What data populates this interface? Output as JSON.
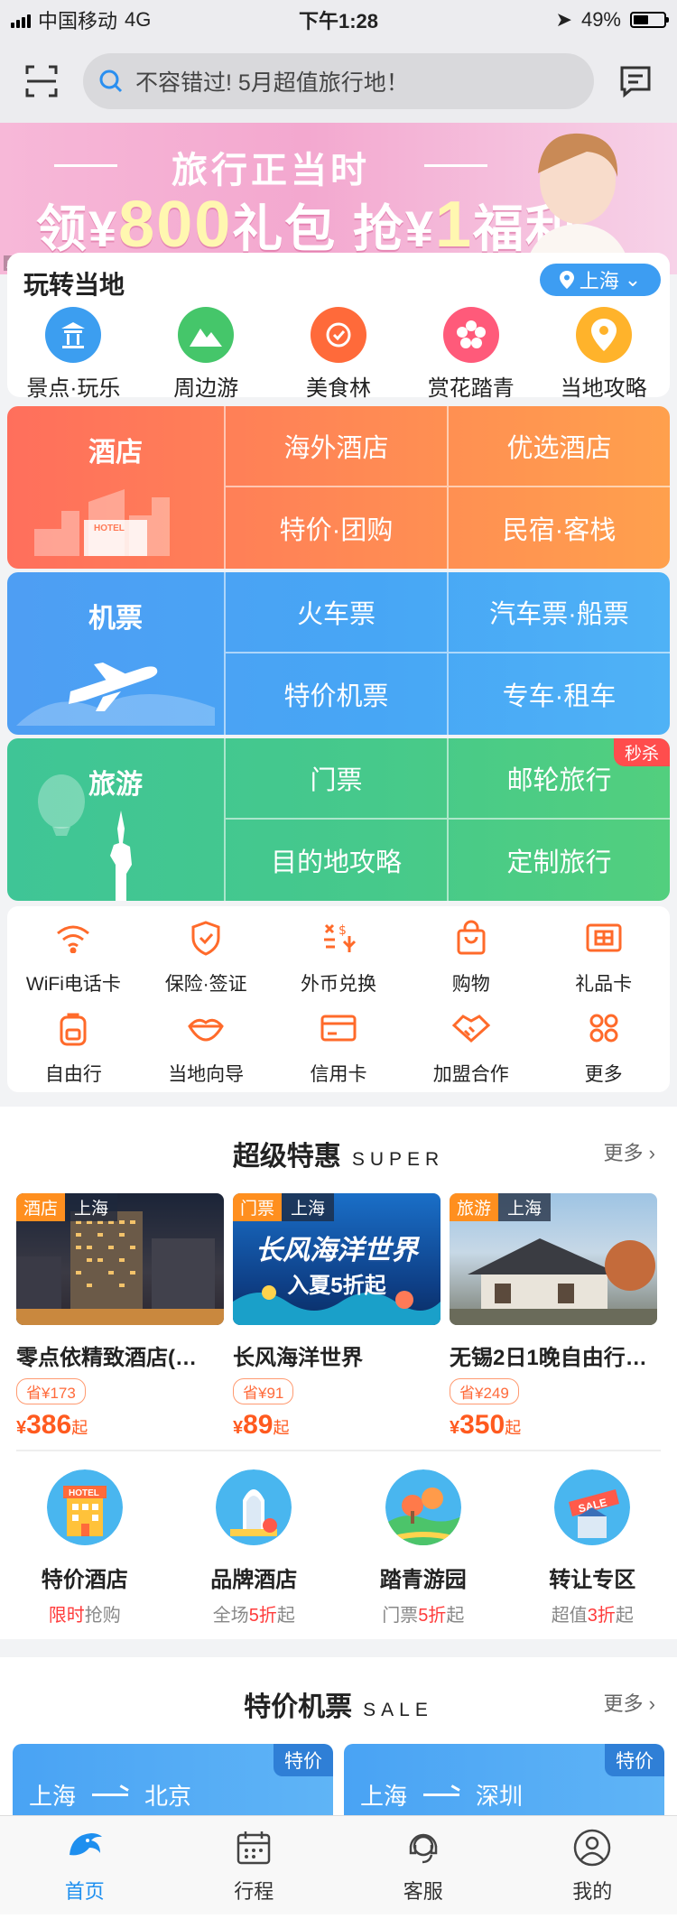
{
  "status_bar": {
    "carrier": "中国移动",
    "network": "4G",
    "time": "下午1:28",
    "battery": "49%",
    "battery_level": 0.49
  },
  "header": {
    "search_placeholder": "不容错过! 5月超值旅行地！"
  },
  "banner": {
    "line1": "旅行正当时",
    "line2_a": "领¥",
    "line2_num": "800",
    "line2_b": "礼包 抢¥",
    "line2_num2": "1",
    "line2_c": "福利",
    "ad_tag": "广告"
  },
  "local": {
    "title": "玩转当地",
    "city": "上海",
    "items": [
      {
        "label": "景点·玩乐",
        "icon": "attraction-icon",
        "color": "#3c9ef0"
      },
      {
        "label": "周边游",
        "icon": "mountain-icon",
        "color": "#45c66a"
      },
      {
        "label": "美食林",
        "icon": "food-icon",
        "color": "#ff6a3a"
      },
      {
        "label": "赏花踏青",
        "icon": "flower-icon",
        "color": "#ff5a7a"
      },
      {
        "label": "当地攻略",
        "icon": "guide-icon",
        "color": "#ffb32b"
      }
    ]
  },
  "grid": {
    "hotel": {
      "main": "酒店",
      "cells": [
        "海外酒店",
        "优选酒店",
        "特价·团购",
        "民宿·客栈"
      ]
    },
    "flight": {
      "main": "机票",
      "cells": [
        "火车票",
        "汽车票·船票",
        "特价机票",
        "专车·租车"
      ]
    },
    "tour": {
      "main": "旅游",
      "cells": [
        "门票",
        "邮轮旅行",
        "目的地攻略",
        "定制旅行"
      ],
      "badge": "秒杀"
    }
  },
  "services": [
    {
      "label": "WiFi电话卡",
      "icon": "wifi-icon"
    },
    {
      "label": "保险·签证",
      "icon": "shield-icon"
    },
    {
      "label": "外币兑换",
      "icon": "currency-exchange-icon"
    },
    {
      "label": "购物",
      "icon": "shopping-bag-icon"
    },
    {
      "label": "礼品卡",
      "icon": "gift-card-icon"
    },
    {
      "label": "自由行",
      "icon": "backpack-icon"
    },
    {
      "label": "当地向导",
      "icon": "guide-lips-icon"
    },
    {
      "label": "信用卡",
      "icon": "credit-card-icon"
    },
    {
      "label": "加盟合作",
      "icon": "handshake-icon"
    },
    {
      "label": "更多",
      "icon": "more-grid-icon"
    }
  ],
  "super": {
    "title": "超级特惠",
    "title_en": "SUPER",
    "more": "更多",
    "deals": [
      {
        "tag": "酒店",
        "city": "上海",
        "name": "零点依精致酒店(…",
        "save": "省¥173",
        "currency": "¥",
        "price": "386",
        "unit": "起"
      },
      {
        "tag": "门票",
        "city": "上海",
        "name": "长风海洋世界",
        "save": "省¥91",
        "currency": "¥",
        "price": "89",
        "unit": "起",
        "img_title": "长风海洋世界",
        "img_sub": "入夏5折起"
      },
      {
        "tag": "旅游",
        "city": "上海",
        "name": "无锡2日1晚自由行…",
        "save": "省¥249",
        "currency": "¥",
        "price": "350",
        "unit": "起"
      }
    ],
    "promos": [
      {
        "title": "特价酒店",
        "sub_a": "",
        "sub_hl": "限时",
        "sub_b": "抢购"
      },
      {
        "title": "品牌酒店",
        "sub_a": "全场",
        "sub_hl": "5折",
        "sub_b": "起"
      },
      {
        "title": "踏青游园",
        "sub_a": "门票",
        "sub_hl": "5折",
        "sub_b": "起"
      },
      {
        "title": "转让专区",
        "sub_a": "超值",
        "sub_hl": "3折",
        "sub_b": "起"
      }
    ]
  },
  "sale": {
    "title": "特价机票",
    "title_en": "SALE",
    "more": "更多",
    "flights": [
      {
        "badge": "特价",
        "from": "上海",
        "to": "北京"
      },
      {
        "badge": "特价",
        "from": "上海",
        "to": "深圳"
      }
    ]
  },
  "tabbar": [
    {
      "label": "首页",
      "icon": "home-dolphin-icon",
      "active": true
    },
    {
      "label": "行程",
      "icon": "calendar-icon",
      "active": false
    },
    {
      "label": "客服",
      "icon": "headset-icon",
      "active": false
    },
    {
      "label": "我的",
      "icon": "user-icon",
      "active": false
    }
  ],
  "colors": {
    "accent": "#1e8fef",
    "price": "#ff5a1f",
    "hotel": "#ff7a57",
    "flight": "#4da2f4",
    "tour": "#45c98c"
  }
}
